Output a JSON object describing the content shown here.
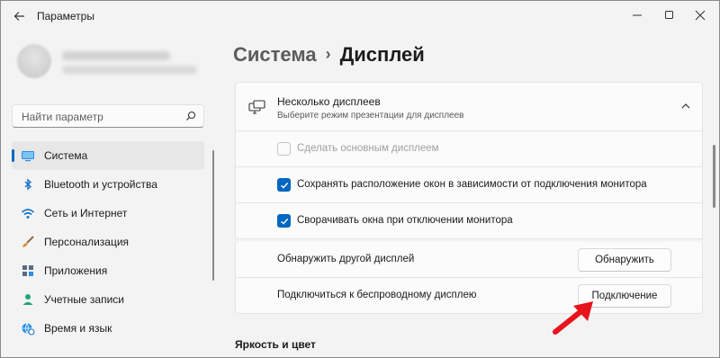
{
  "window": {
    "title": "Параметры"
  },
  "search": {
    "placeholder": "Найти параметр"
  },
  "sidebar": {
    "items": [
      {
        "label": "Система",
        "icon": "system-icon",
        "active": true
      },
      {
        "label": "Bluetooth и устройства",
        "icon": "bluetooth-icon"
      },
      {
        "label": "Сеть и Интернет",
        "icon": "network-icon"
      },
      {
        "label": "Персонализация",
        "icon": "brush-icon"
      },
      {
        "label": "Приложения",
        "icon": "apps-icon"
      },
      {
        "label": "Учетные записи",
        "icon": "account-icon"
      },
      {
        "label": "Время и язык",
        "icon": "globe-clock-icon"
      }
    ]
  },
  "breadcrumb": {
    "parent": "Система",
    "separator": "›",
    "current": "Дисплей"
  },
  "multi_display": {
    "title": "Несколько дисплеев",
    "subtitle": "Выберите режим презентации для дисплеев",
    "options": [
      {
        "label": "Сделать основным дисплеем",
        "checked": false,
        "disabled": true
      },
      {
        "label": "Сохранять расположение окон в зависимости от подключения монитора",
        "checked": true
      },
      {
        "label": "Сворачивать окна при отключении монитора",
        "checked": true
      }
    ],
    "detect": {
      "label": "Обнаружить другой дисплей",
      "button": "Обнаружить"
    },
    "wireless": {
      "label": "Подключиться к беспроводному дисплею",
      "button": "Подключение"
    }
  },
  "section_next": "Яркость и цвет",
  "colors": {
    "accent": "#0067c0",
    "arrow": "#e8141b"
  }
}
